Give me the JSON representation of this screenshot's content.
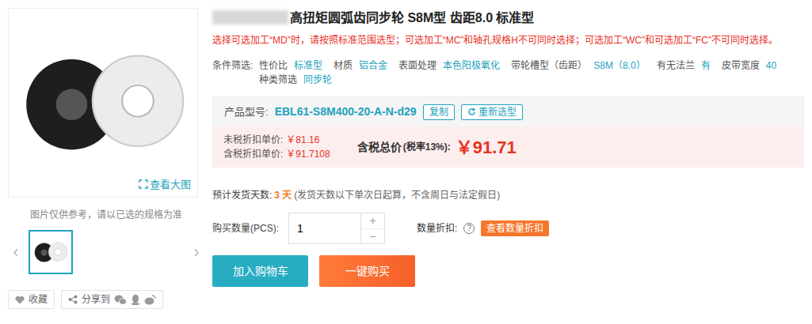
{
  "product": {
    "title": "高扭矩圆弧齿同步轮 S8M型 齿距8.0 标准型",
    "notice": "选择可选加工“MD”时，请按照标准范围选型；可选加工“MC”和轴孔规格H不可同时选择；可选加工“WC”和可选加工“FC”不可同时选择。"
  },
  "gallery": {
    "view_large": "查看大图",
    "caption": "图片仅供参考，请以已选的规格为准",
    "prev": "‹",
    "next": "›",
    "thumbnails": [
      {
        "selected": true
      }
    ]
  },
  "social": {
    "favorite": "收藏",
    "share": "分享到"
  },
  "filters": {
    "label": "条件筛选:",
    "items": [
      {
        "label": "性价比",
        "value": "标准型"
      },
      {
        "label": "材质",
        "value": "铝合金"
      },
      {
        "label": "表面处理",
        "value": "本色阳极氧化"
      },
      {
        "label": "带轮槽型（齿距）",
        "value": "S8M（8.0）"
      },
      {
        "label": "有无法兰",
        "value": "有"
      },
      {
        "label": "皮带宽度",
        "value": "40"
      },
      {
        "label": "种类筛选",
        "value": "同步轮"
      }
    ]
  },
  "model": {
    "label": "产品型号:",
    "value": "EBL61-S8M400-20-A-N-d29",
    "copy": "复制",
    "reselect": "重新选型"
  },
  "prices": {
    "rows": [
      {
        "label": "未税折扣单价:",
        "value": "￥81.16"
      },
      {
        "label": "含税折扣单价:",
        "value": "￥91.7108"
      }
    ],
    "total": {
      "label": "含税总价",
      "tax": "(税率13%):",
      "value": "￥91.71"
    }
  },
  "shipping": {
    "label": "预计发货天数:",
    "days": "3 天",
    "note": "(发货天数以下单次日起算，不含周日与法定假日)"
  },
  "quantity": {
    "label": "购买数量(PCS):",
    "value": "1",
    "plus": "+",
    "minus": "−",
    "discount_label": "数量折扣:",
    "help": "?",
    "discount_button": "查看数量折扣"
  },
  "buttons": [
    "加入购物车",
    "一键购买"
  ]
}
